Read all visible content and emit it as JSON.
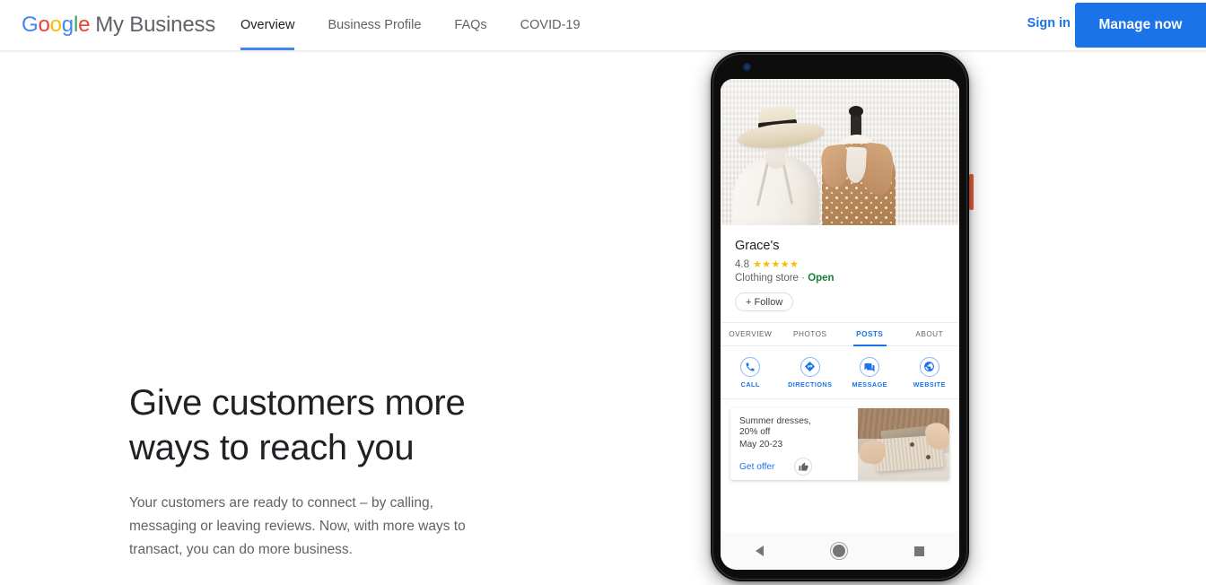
{
  "header": {
    "brand": {
      "google": [
        "G",
        "o",
        "o",
        "g",
        "l",
        "e"
      ],
      "product": "My Business"
    },
    "nav": [
      {
        "label": "Overview",
        "active": true
      },
      {
        "label": "Business Profile",
        "active": false
      },
      {
        "label": "FAQs",
        "active": false
      },
      {
        "label": "COVID-19",
        "active": false
      }
    ],
    "signin_label": "Sign in",
    "manage_label": "Manage now",
    "accent_blue": "#1A73E8"
  },
  "hero": {
    "title": "Give customers more ways to reach you",
    "body": "Your customers are ready to connect – by calling, messaging or leaving reviews. Now, with more ways to transact, you can do more business."
  },
  "phone": {
    "business": {
      "name": "Grace's",
      "rating_value": "4.8",
      "stars": "★★★★★",
      "category_status": "Clothing store · ",
      "status": "Open",
      "follow_label": "+ Follow"
    },
    "tabs": [
      {
        "label": "OVERVIEW",
        "active": false
      },
      {
        "label": "PHOTOS",
        "active": false
      },
      {
        "label": "POSTS",
        "active": true
      },
      {
        "label": "ABOUT",
        "active": false
      }
    ],
    "actions": [
      {
        "label": "CALL",
        "icon": "phone-icon"
      },
      {
        "label": "DIRECTIONS",
        "icon": "directions-icon"
      },
      {
        "label": "MESSAGE",
        "icon": "message-icon"
      },
      {
        "label": "WEBSITE",
        "icon": "globe-icon"
      }
    ],
    "post": {
      "title_line1": "Summer dresses,",
      "title_line2": "20% off",
      "date": "May 20-23",
      "cta": "Get offer",
      "thumb_icon": "thumbs-up-icon"
    },
    "navbar": {
      "back": "back-triangle-icon",
      "home": "home-circle-icon",
      "recents": "recents-square-icon"
    },
    "status_green": "#188038",
    "star_gold": "#FBBC04"
  }
}
